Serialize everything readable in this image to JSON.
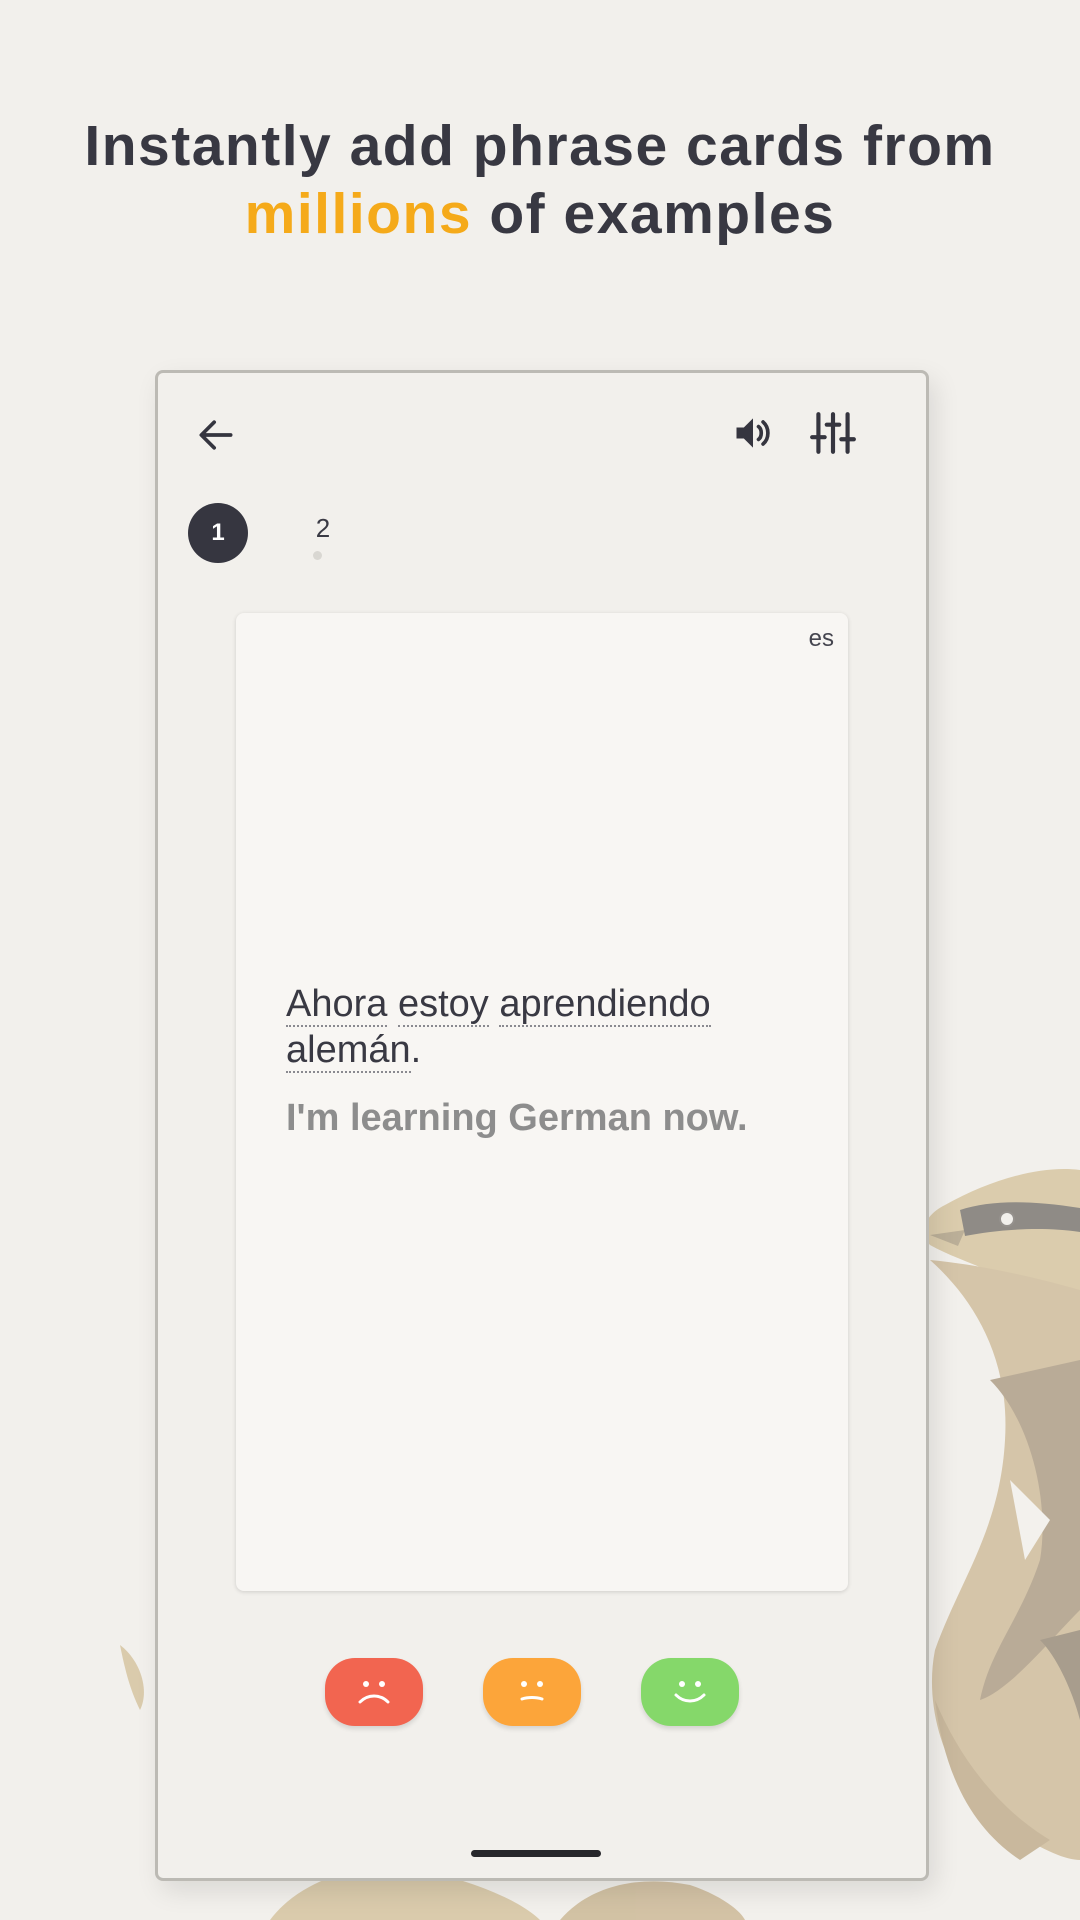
{
  "headline": {
    "line1": "Instantly add phrase cards from",
    "accent": "millions",
    "rest": " of examples"
  },
  "colors": {
    "accent": "#f5aa1a",
    "dark": "#363640",
    "hard": "#f26550",
    "ok": "#fca53a",
    "easy": "#85d86a"
  },
  "toolbar": {
    "back_icon": "arrow-left-icon",
    "sound_icon": "speaker-icon",
    "settings_icon": "sliders-icon"
  },
  "steps": {
    "active": "1",
    "next": "2"
  },
  "card": {
    "lang": "es",
    "spanish_words": [
      "Ahora",
      "estoy",
      "aprendiendo",
      "alemán"
    ],
    "spanish_punct": ".",
    "english": "I'm learning German now."
  },
  "rating": {
    "hard_icon": "sad-face-icon",
    "ok_icon": "neutral-face-icon",
    "easy_icon": "happy-face-icon"
  }
}
